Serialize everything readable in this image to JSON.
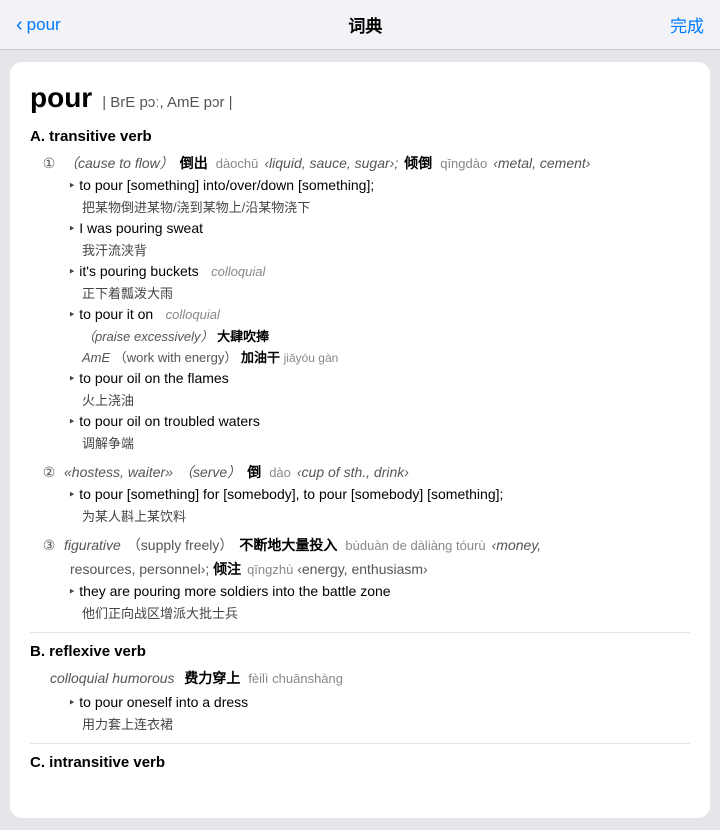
{
  "nav": {
    "back_label": "pour",
    "title": "词典",
    "done_label": "完成"
  },
  "word": {
    "headword": "pour",
    "pronunciation": "| BrE pɔː,  AmE pɔr |"
  },
  "sections": [
    {
      "id": "A",
      "label": "A.",
      "pos": "transitive verb",
      "senses": [
        {
          "num": "①",
          "gloss": "（cause to flow）",
          "translations": [
            {
              "word": "倒出",
              "pinyin": "dàochū",
              "collocate": "‹liquid, sauce, sugar›"
            },
            {
              "word": "倾倒",
              "pinyin": "qīngdào",
              "collocate": "‹metal, cement›"
            }
          ],
          "examples": [
            {
              "en": "to pour [something] into/over/down [something];",
              "zh": "把某物倒进某物/浇到某物上/沿某物浇下",
              "label": ""
            },
            {
              "en": "I was pouring sweat",
              "zh": "我汗流浃背",
              "label": ""
            },
            {
              "en": "it's pouring buckets",
              "zh": "正下着瓢泼大雨",
              "label": "colloquial"
            },
            {
              "en": "to pour it on",
              "zh": "",
              "label": "colloquial",
              "subgloss1": "（praise excessively）",
              "subtrans1": "大肆吹捧",
              "subgloss2": "AmE（work with energy）",
              "subtrans2": "加油干",
              "subpinyin2": "jiāyóu gàn"
            },
            {
              "en": "to pour oil on the flames",
              "zh": "火上浇油",
              "label": ""
            },
            {
              "en": "to pour oil on troubled waters",
              "zh": "调解争端",
              "label": ""
            }
          ]
        },
        {
          "num": "②",
          "gloss": "（serve）",
          "translations": [
            {
              "word": "倒",
              "pinyin": "dào",
              "collocate": "‹cup of sth., drink›"
            }
          ],
          "examples": [
            {
              "en": "to pour [something] for [somebody], to pour [somebody] [something];",
              "zh": "为某人斟上某饮料",
              "label": "",
              "prefix": "«hostess, waiter»"
            }
          ]
        },
        {
          "num": "③",
          "gloss": "figurative（supply freely）",
          "translations": [
            {
              "word": "不断地大量投入",
              "pinyin": "bùduàn de dàliàng tóurù",
              "collocate": "‹money, resources, personnel›"
            },
            {
              "word": "倾注",
              "pinyin": "qīngzhù",
              "collocate": "‹energy, enthusiasm›"
            }
          ],
          "examples": [
            {
              "en": "they are pouring more soldiers into the battle zone",
              "zh": "他们正向战区增派大批士兵",
              "label": ""
            }
          ]
        }
      ]
    },
    {
      "id": "B",
      "label": "B.",
      "pos": "reflexive verb",
      "header_note": "colloquial humorous",
      "header_trans": "费力穿上",
      "header_pinyin": "fèilì chuānshàng",
      "senses": [
        {
          "num": "",
          "gloss": "",
          "translations": [],
          "examples": [
            {
              "en": "to pour oneself into a dress",
              "zh": "用力套上连衣裙",
              "label": ""
            }
          ]
        }
      ]
    },
    {
      "id": "C",
      "label": "C.",
      "pos": "intransitive verb",
      "senses": []
    }
  ]
}
